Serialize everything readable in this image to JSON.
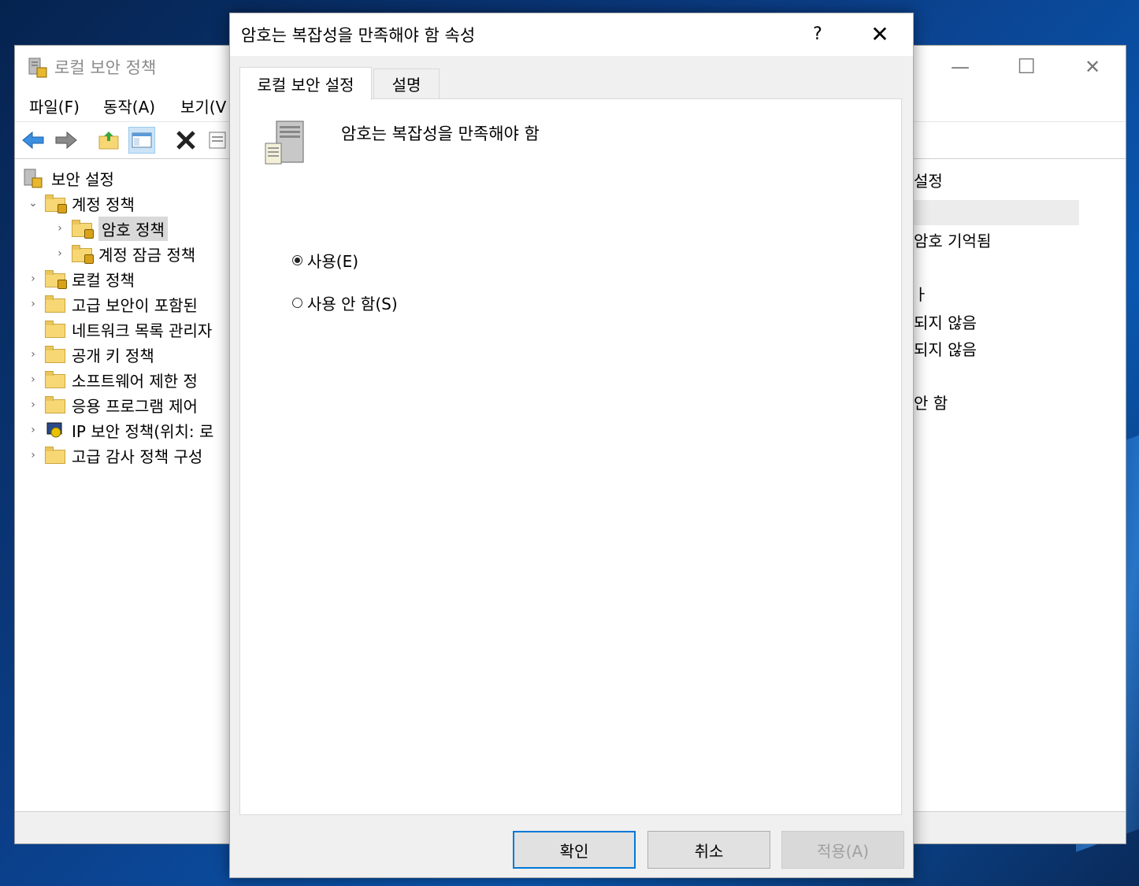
{
  "background_window": {
    "title": "로컬 보안 정책",
    "window_buttons": {
      "minimize": "—",
      "maximize": "☐",
      "close": "✕"
    },
    "menu": [
      "파일(F)",
      "동작(A)",
      "보기(V"
    ],
    "toolbar_icons": [
      "back-arrow-icon",
      "forward-arrow-icon",
      "up-folder-icon",
      "show-hide-tree-icon",
      "delete-icon",
      "properties-icon"
    ],
    "tree": [
      {
        "label": "보안 설정",
        "chevron": ""
      },
      {
        "label": "계정 정책",
        "chevron": "⌄"
      },
      {
        "label": "암호 정책",
        "chevron": "›",
        "selected": true
      },
      {
        "label": "계정 잠금 정책",
        "chevron": "›"
      },
      {
        "label": "로컬 정책",
        "chevron": "›"
      },
      {
        "label": "고급 보안이 포함된",
        "chevron": "›"
      },
      {
        "label": "네트워크 목록 관리자",
        "chevron": ""
      },
      {
        "label": "공개 키 정책",
        "chevron": "›"
      },
      {
        "label": "소프트웨어 제한 정",
        "chevron": "›"
      },
      {
        "label": "응용 프로그램 제어",
        "chevron": "›"
      },
      {
        "label": "IP 보안 정책(위치: 로",
        "chevron": "›"
      },
      {
        "label": "고급 감사 정책 구성",
        "chevron": "›"
      }
    ],
    "scroll_left": "<",
    "right_pane": {
      "header": "설정",
      "items": [
        "암호 기억됨",
        "ㅏ",
        "되지 않음",
        "되지 않음",
        "안 함"
      ]
    }
  },
  "dialog": {
    "title": "암호는 복잡성을 만족해야 함 속성",
    "help": "?",
    "close": "✕",
    "tabs": {
      "active": "로컬 보안 설정",
      "inactive": "설명"
    },
    "policy_name": "암호는 복잡성을 만족해야 함",
    "radios": {
      "enabled": "사용(E)",
      "disabled": "사용 안 함(S)",
      "selected": "enabled"
    },
    "buttons": {
      "ok": "확인",
      "cancel": "취소",
      "apply": "적용(A)"
    }
  }
}
